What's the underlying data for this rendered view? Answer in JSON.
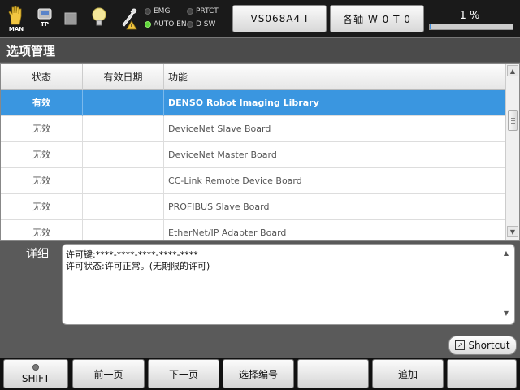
{
  "status_bar": {
    "mode_icons": [
      {
        "name": "man-hand-icon",
        "label": "MAN"
      },
      {
        "name": "teach-pendant-icon",
        "label": "TP"
      },
      {
        "name": "stop-square-icon",
        "label": ""
      },
      {
        "name": "lightbulb-icon",
        "label": ""
      },
      {
        "name": "wrench-warning-icon",
        "label": ""
      }
    ],
    "lamps": [
      {
        "label": "EMG",
        "on": false
      },
      {
        "label": "PRTCT",
        "on": false
      },
      {
        "label": "AUTO EN",
        "on": true
      },
      {
        "label": "D SW",
        "on": false
      }
    ],
    "version_button": "VS068A4 I",
    "axis_button": "各轴  W 0 T 0",
    "percent_text": "1 %",
    "progress_value": 0.01
  },
  "title": "选项管理",
  "table": {
    "headers": [
      "状态",
      "有效日期",
      "功能"
    ],
    "rows": [
      {
        "status": "有效",
        "date": "",
        "function": "DENSO Robot Imaging Library",
        "selected": true
      },
      {
        "status": "无效",
        "date": "",
        "function": "DeviceNet Slave Board",
        "selected": false
      },
      {
        "status": "无效",
        "date": "",
        "function": "DeviceNet Master Board",
        "selected": false
      },
      {
        "status": "无效",
        "date": "",
        "function": "CC-Link Remote Device Board",
        "selected": false
      },
      {
        "status": "无效",
        "date": "",
        "function": "PROFIBUS Slave Board",
        "selected": false
      },
      {
        "status": "无效",
        "date": "",
        "function": "EtherNet/IP Adapter Board",
        "selected": false
      }
    ]
  },
  "detail": {
    "label": "详细",
    "lines": [
      "许可键:****-****-****-****-****",
      "许可状态:许可正常。(无期限的许可)"
    ]
  },
  "shortcut_label": "Shortcut",
  "function_keys": {
    "shift": "SHIFT",
    "keys": [
      "前一页",
      "下一页",
      "选择编号",
      "",
      "追加",
      ""
    ]
  },
  "colors": {
    "selection": "#3a96e0",
    "lamp_on": "#5fd43a",
    "background": "#5a5a5a"
  }
}
